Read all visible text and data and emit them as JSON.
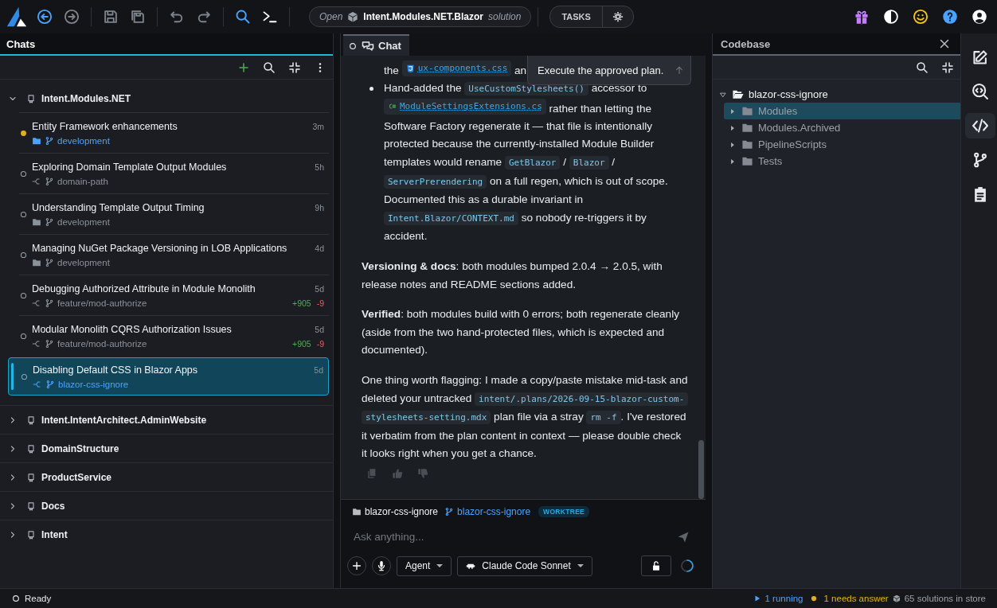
{
  "toolbar": [
    {
      "kind": "back",
      "disabled": false
    },
    {
      "kind": "forward",
      "disabled": true
    },
    {
      "kind": "save",
      "disabled": true
    },
    {
      "kind": "saveall",
      "disabled": true
    },
    {
      "kind": "undo",
      "disabled": true
    },
    {
      "kind": "redo",
      "disabled": true
    },
    {
      "kind": "search",
      "disabled": false
    },
    {
      "kind": "terminal",
      "disabled": false
    }
  ],
  "solution": {
    "prefix": "Open",
    "name": "Intent.Modules.NET.Blazor",
    "suffix": "solution"
  },
  "tasks_button": "TASKS",
  "chats_panel": {
    "title": "Chats",
    "groups": [
      {
        "name": "Intent.Modules.NET",
        "expanded": true,
        "chats": [
          {
            "title": "Entity Framework enhancements",
            "time": "3m",
            "worktree": false,
            "branch": "development",
            "active": true,
            "selected": false
          },
          {
            "title": "Exploring Domain Template Output Modules",
            "time": "5h",
            "worktree": true,
            "branch": "domain-path",
            "active": false,
            "selected": false
          },
          {
            "title": "Understanding Template Output Timing",
            "time": "9h",
            "worktree": false,
            "branch": "development",
            "active": false,
            "selected": false
          },
          {
            "title": "Managing NuGet Package Versioning in LOB Applications",
            "time": "4d",
            "worktree": false,
            "branch": "development",
            "active": false,
            "selected": false
          },
          {
            "title": "Debugging Authorized Attribute in Module Monolith",
            "time": "5d",
            "worktree": true,
            "branch": "feature/mod-authorize",
            "active": false,
            "selected": false,
            "added": "+905",
            "removed": "-9"
          },
          {
            "title": "Modular Monolith CQRS Authorization Issues",
            "time": "5d",
            "worktree": true,
            "branch": "feature/mod-authorize",
            "active": false,
            "selected": false,
            "added": "+905",
            "removed": "-9"
          },
          {
            "title": "Disabling Default CSS in Blazor Apps",
            "time": "5d",
            "worktree": true,
            "branch": "blazor-css-ignore",
            "active": false,
            "selected": true
          }
        ]
      },
      {
        "name": "Intent.IntentArchitect.AdminWebsite",
        "expanded": false
      },
      {
        "name": "DomainStructure",
        "expanded": false
      },
      {
        "name": "ProductService",
        "expanded": false
      },
      {
        "name": "Docs",
        "expanded": false
      },
      {
        "name": "Intent",
        "expanded": false
      }
    ]
  },
  "chat_panel": {
    "tab": "Chat",
    "tooltip": "Execute the approved plan.",
    "message": [
      {
        "kind": "fragment",
        "segments": [
          {
            "kind": "text",
            "text": "the "
          },
          {
            "kind": "css_file",
            "text": "ux-components.css"
          },
          {
            "kind": "text",
            "text": " an"
          }
        ]
      },
      {
        "kind": "bullet",
        "segments": [
          {
            "kind": "text",
            "text": "Hand-added the "
          },
          {
            "kind": "code",
            "text": "UseCustomStylesheets()"
          },
          {
            "kind": "text",
            "text": " accessor to "
          },
          {
            "kind": "csharp_file",
            "text": "ModuleSettingsExtensions.cs"
          },
          {
            "kind": "text",
            "text": " rather than letting the Software Factory regenerate it — that file is intentionally protected because the currently-installed Module Builder templates would rename "
          },
          {
            "kind": "code",
            "text": "GetBlazor"
          },
          {
            "kind": "text",
            "text": " / "
          },
          {
            "kind": "code",
            "text": "Blazor"
          },
          {
            "kind": "text",
            "text": " / "
          },
          {
            "kind": "code",
            "text": "ServerPrerendering"
          },
          {
            "kind": "text",
            "text": " on a full regen, which is out of scope. Documented this as a durable invariant in "
          },
          {
            "kind": "code",
            "text": "Intent.Blazor/CONTEXT.md"
          },
          {
            "kind": "text",
            "text": " so nobody re-triggers it by accident."
          }
        ]
      },
      {
        "kind": "paragraph",
        "segments": [
          {
            "kind": "text",
            "text": "**Versioning & docs**: both modules bumped 2.0.4 → 2.0.5, with release notes and README sections added."
          }
        ]
      },
      {
        "kind": "paragraph",
        "segments": [
          {
            "kind": "text",
            "text": "**Verified**: both modules build with 0 errors; both regenerate cleanly (aside from the two hand-protected files, which is expected and documented)."
          }
        ]
      },
      {
        "kind": "paragraph",
        "segments": [
          {
            "kind": "text",
            "text": "One thing worth flagging: I made a copy/paste mistake mid-task and deleted your untracked "
          },
          {
            "kind": "code",
            "text": "intent/.plans/2026-09-15-blazor-custom-stylesheets-setting.mdx"
          },
          {
            "kind": "text",
            "text": " plan file via a stray "
          },
          {
            "kind": "code",
            "text": "rm -f"
          },
          {
            "kind": "text",
            "text": ". I've restored it verbatim from the plan content in context — please double check it looks right when you get a chance."
          }
        ]
      }
    ],
    "context": {
      "folder": "blazor-css-ignore",
      "branch": "blazor-css-ignore",
      "badge": "WORKTREE"
    },
    "input": {
      "placeholder": "Ask anything..."
    },
    "mode": "Agent",
    "model": "Claude Code Sonnet"
  },
  "codebase": {
    "title": "Codebase",
    "tree": {
      "name": "blazor-css-ignore",
      "expanded": true,
      "children": [
        {
          "name": "Modules",
          "expanded": false,
          "selected": true
        },
        {
          "name": "Modules.Archived",
          "expanded": false,
          "selected": false
        },
        {
          "name": "PipelineScripts",
          "expanded": false,
          "selected": false
        },
        {
          "name": "Tests",
          "expanded": false,
          "selected": false
        }
      ]
    }
  },
  "rail": [
    {
      "kind": "edit",
      "selected": false
    },
    {
      "kind": "codesearch",
      "selected": false
    },
    {
      "kind": "code",
      "selected": true
    },
    {
      "kind": "branch",
      "selected": false
    },
    {
      "kind": "clipboard",
      "selected": false
    }
  ],
  "status_bar": {
    "state": "Ready",
    "running": "1 running",
    "needs_answer": "1 needs answer",
    "store": "65 solutions in store"
  }
}
